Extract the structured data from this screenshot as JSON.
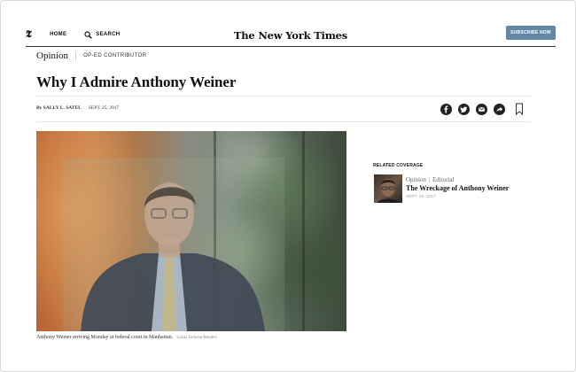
{
  "header": {
    "t_logo": "𝕿",
    "home_label": "HOME",
    "search_label": "SEARCH",
    "masthead_title": "The New York Times",
    "subscribe_label": "SUBSCRIBE NOW"
  },
  "article": {
    "section": "Opinion",
    "kicker": "OP-ED CONTRIBUTOR",
    "headline": "Why I Admire Anthony Weiner",
    "byline": "By SALLY L. SATEL",
    "date": "SEPT. 25, 2017",
    "share_icons": [
      "facebook-icon",
      "twitter-icon",
      "email-icon",
      "share-icon",
      "bookmark-icon"
    ],
    "image_caption": "Anthony Weiner arriving Monday at federal court in Manhattan.",
    "image_credit": "Lucas Jackson/Reuters"
  },
  "related": {
    "heading": "RELATED COVERAGE",
    "items": [
      {
        "section": "Opinion",
        "kicker": "Editorial",
        "title": "The Wreckage of Anthony Weiner",
        "date": "SEPT. 25, 2017"
      }
    ]
  },
  "colors": {
    "subscribe_bg": "#6288a5",
    "text": "#121212",
    "share_icon_bg": "#222222"
  }
}
